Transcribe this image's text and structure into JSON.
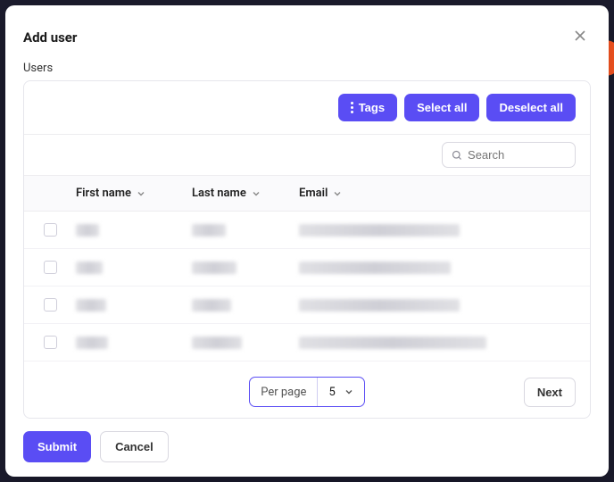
{
  "modal": {
    "title": "Add user",
    "section_label": "Users"
  },
  "toolbar": {
    "tags_label": "Tags",
    "select_all_label": "Select all",
    "deselect_all_label": "Deselect all"
  },
  "search": {
    "placeholder": "Search",
    "value": ""
  },
  "table": {
    "columns": {
      "first_name": "First name",
      "last_name": "Last name",
      "email": "Email"
    },
    "rows": [
      {
        "first_name": "",
        "last_name": "",
        "email": ""
      },
      {
        "first_name": "",
        "last_name": "",
        "email": ""
      },
      {
        "first_name": "",
        "last_name": "",
        "email": ""
      },
      {
        "first_name": "",
        "last_name": "",
        "email": ""
      },
      {
        "first_name": "",
        "last_name": "",
        "email": ""
      }
    ],
    "row_widths": [
      {
        "fn": 26,
        "ln": 38,
        "em": 180
      },
      {
        "fn": 30,
        "ln": 50,
        "em": 170
      },
      {
        "fn": 34,
        "ln": 44,
        "em": 180
      },
      {
        "fn": 36,
        "ln": 56,
        "em": 210
      },
      {
        "fn": 34,
        "ln": 40,
        "em": 195
      }
    ]
  },
  "pagination": {
    "per_page_label": "Per page",
    "per_page_value": "5",
    "next_label": "Next"
  },
  "footer": {
    "submit_label": "Submit",
    "cancel_label": "Cancel"
  }
}
